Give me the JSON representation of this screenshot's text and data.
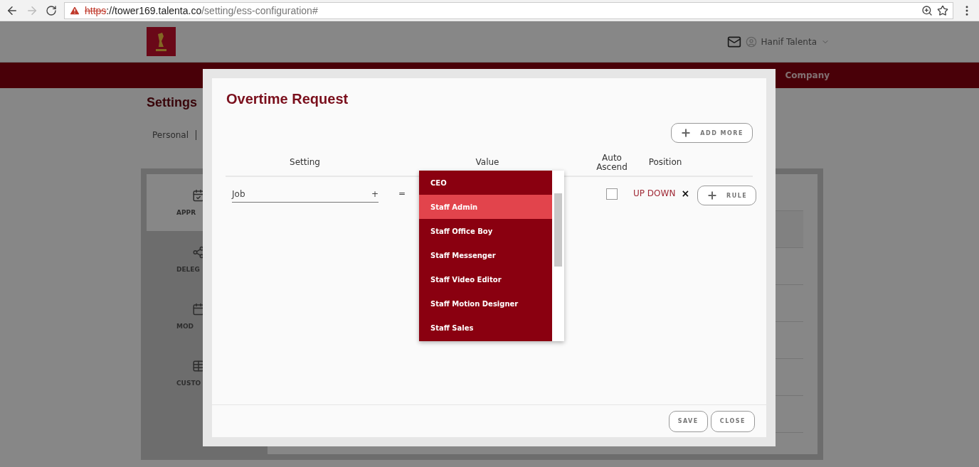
{
  "browser": {
    "url_scheme": "https",
    "url_rest": "://tower169.talenta.co",
    "url_path": "/setting/ess-configuration#"
  },
  "header": {
    "user_name": "Hanif Talenta"
  },
  "nav": {
    "items": [
      "Company"
    ]
  },
  "page": {
    "title": "Settings",
    "tabs": [
      "Personal"
    ],
    "sidebar": [
      {
        "label": "APPR",
        "selected": true
      },
      {
        "label": "DELEG",
        "selected": false
      },
      {
        "label": "MOD",
        "selected": false
      },
      {
        "label": "CUSTO",
        "selected": false
      }
    ]
  },
  "modal": {
    "title": "Overtime Request",
    "add_more": "ADD MORE",
    "columns": [
      "Setting",
      "Value",
      "Auto Ascend",
      "Position"
    ],
    "rows": [
      {
        "setting": "Job",
        "plus": "+",
        "operator": "=",
        "auto_ascend": false,
        "position": "UP DOWN",
        "remove": "×",
        "rule_button": "RULE"
      }
    ],
    "dropdown": [
      {
        "label": "CEO",
        "selected": false
      },
      {
        "label": "Staff Admin",
        "selected": true
      },
      {
        "label": "Staff Office Boy",
        "selected": false
      },
      {
        "label": "Staff Messenger",
        "selected": false
      },
      {
        "label": "Staff Video Editor",
        "selected": false
      },
      {
        "label": "Staff Motion Designer",
        "selected": false
      },
      {
        "label": "Staff Sales",
        "selected": false
      }
    ],
    "buttons": [
      "SAVE",
      "CLOSE"
    ]
  }
}
